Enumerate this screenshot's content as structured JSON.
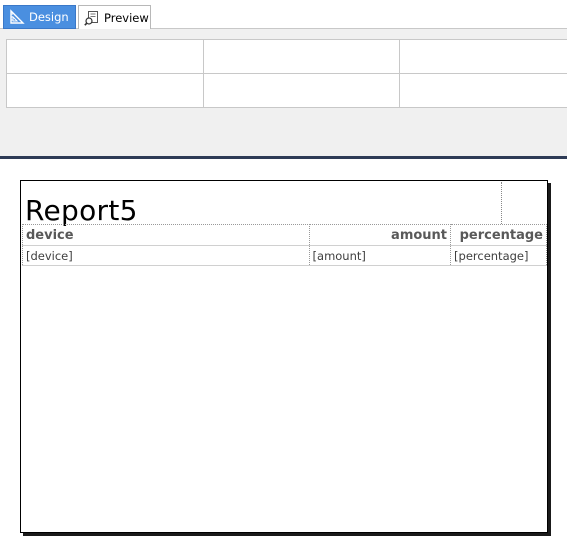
{
  "tabs": [
    {
      "label": "Design",
      "icon": "design-ruler-icon",
      "active": true
    },
    {
      "label": "Preview",
      "icon": "preview-page-icon",
      "active": false
    }
  ],
  "report": {
    "title": "Report5",
    "columns": [
      {
        "header": "device",
        "field": "[device]"
      },
      {
        "header": "amount",
        "field": "[amount]"
      },
      {
        "header": "percentage",
        "field": "[percentage]"
      }
    ]
  },
  "colors": {
    "active_tab": "#4a8fe0",
    "separator": "#2e3b56",
    "header_text": "#595959"
  }
}
